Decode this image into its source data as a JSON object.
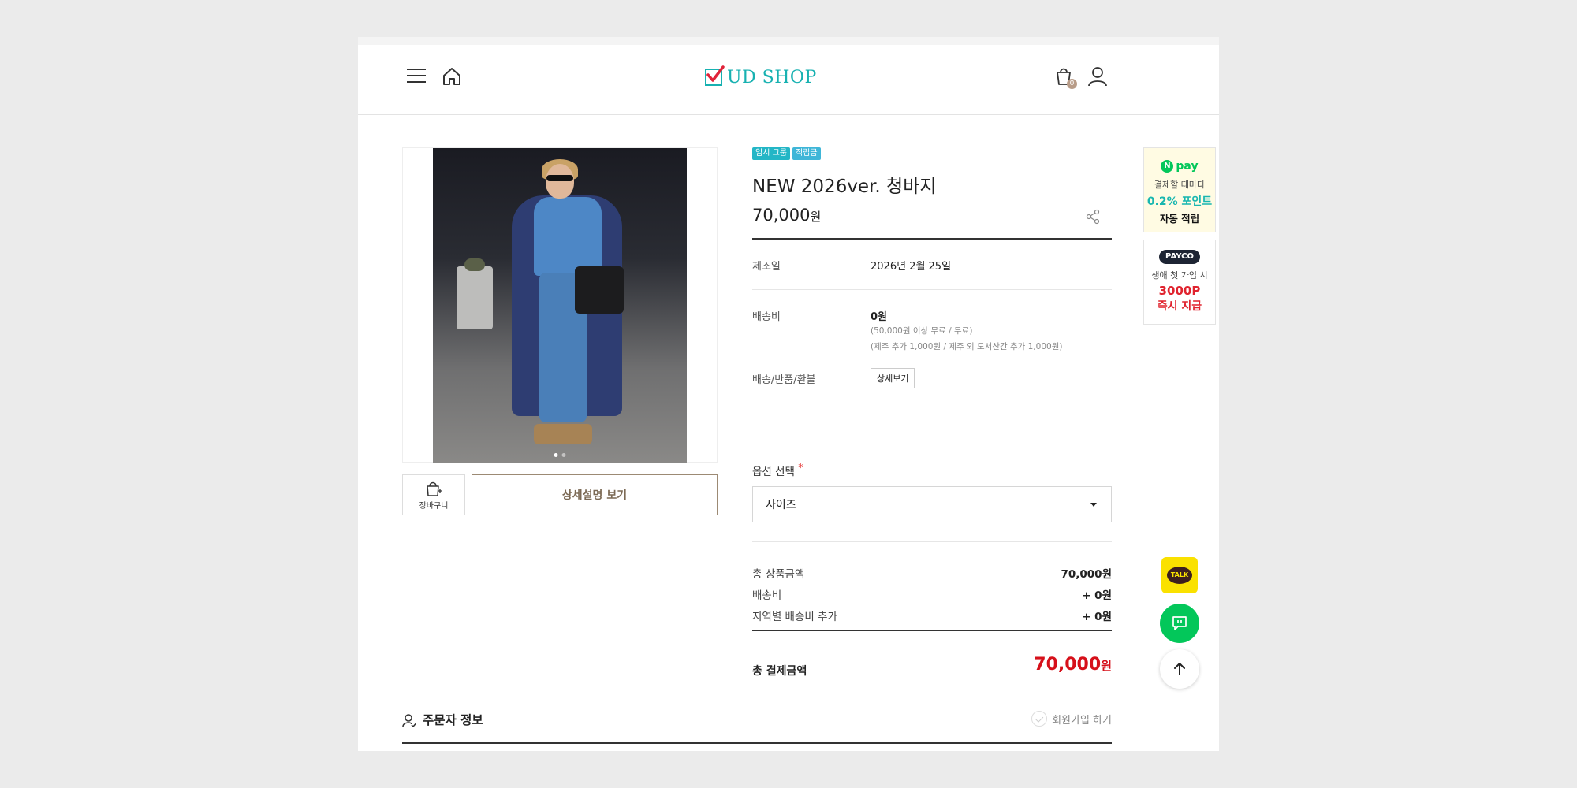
{
  "header": {
    "logo_text": "UD SHOP",
    "cart_count": "0"
  },
  "product": {
    "badges": [
      "임시 그룹",
      "적립금"
    ],
    "title": "NEW 2026ver. 청바지",
    "price": "70,000",
    "price_unit": "원",
    "manufacture_label": "제조일",
    "manufacture_value": "2026년 2월 25일",
    "shipping_label": "배송비",
    "shipping_value": "0원",
    "shipping_note1": "(50,000원 이상 무료 / 무료)",
    "shipping_note2": "(제주 추가 1,000원 / 제주 외 도서산간 추가 1,000원)",
    "return_label": "배송/반품/환불",
    "return_button": "상세보기",
    "option_label": "옵션 선택",
    "option_required": "*",
    "option_selected": "사이즈",
    "cart_button_label": "장바구니",
    "detail_button_label": "상세설명 보기"
  },
  "summary": {
    "items": [
      {
        "label": "총 상품금액",
        "value": "70,000원"
      },
      {
        "label": "배송비",
        "value": "+ 0원"
      },
      {
        "label": "지역별 배송비 추가",
        "value": "+ 0원"
      }
    ],
    "total_label": "총 결제금액",
    "total_value": "70,000",
    "total_unit": "원"
  },
  "orderer": {
    "title": "주문자 정보",
    "join_label": "회원가입 하기"
  },
  "ads": {
    "npay_logo": "pay",
    "npay_line1": "결제할 때마다",
    "npay_line2": "0.2% 포인트",
    "npay_line3": "자동 적립",
    "payco_logo": "PAYCO",
    "payco_line1": "생애 첫 가입 시",
    "payco_line2": "3000P",
    "payco_line3": "즉시 지급"
  },
  "floating": {
    "talk_label": "TALK"
  },
  "colors": {
    "brand": "#17b1b1",
    "total_price": "#d6101a",
    "npay_green": "#03c75a",
    "kakao_yellow": "#fae100"
  }
}
